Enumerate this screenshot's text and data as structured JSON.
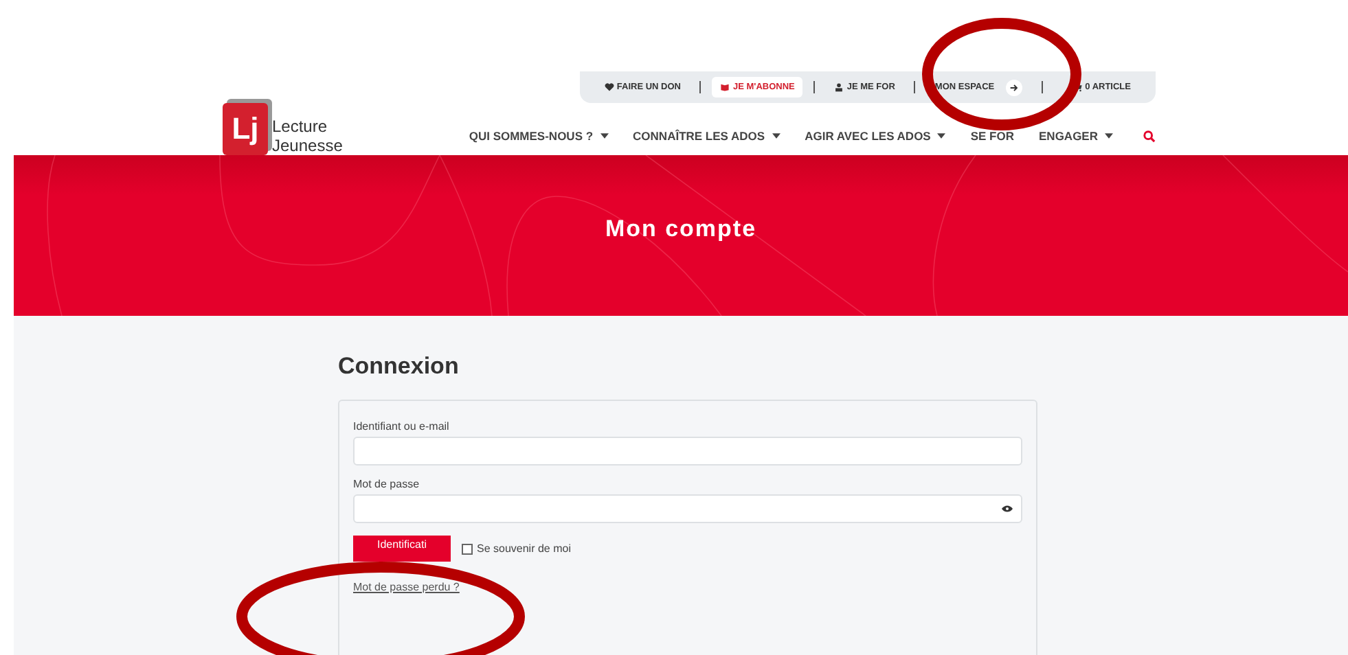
{
  "logo": {
    "line1": "Lecture",
    "line2": "Jeunesse",
    "mark": "Lj"
  },
  "top_bar": [
    {
      "label": "FAIRE UN DON",
      "kind": "heart",
      "selected": false
    },
    {
      "label": "JE M'ABONNE",
      "kind": "book",
      "selected": true
    },
    {
      "label": "JE ME FOR",
      "kind": "person",
      "selected": false
    },
    {
      "label": "MON ESPACE",
      "kind": "arrow",
      "selected": false
    },
    {
      "label": "0 ARTICLE",
      "kind": "cart",
      "selected": false
    }
  ],
  "nav": [
    {
      "label": "QUI SOMMES-NOUS ?",
      "caret": true
    },
    {
      "label": "CONNAÎTRE LES ADOS",
      "caret": true
    },
    {
      "label": "AGIR AVEC LES ADOS",
      "caret": true
    },
    {
      "label": "SE FOR",
      "caret": false
    },
    {
      "label": "ENGAGER",
      "caret": true
    }
  ],
  "banner": {
    "title": "Mon compte"
  },
  "login": {
    "heading": "Connexion",
    "fields": [
      {
        "label": "Identifiant ou e-mail",
        "kind": "text"
      },
      {
        "label": "Mot de passe",
        "kind": "password"
      }
    ],
    "submit": "Identificati",
    "remember": {
      "label": "Se souvenir de moi",
      "checked": false
    },
    "lost_link": "Mot de passe perdu ?"
  }
}
